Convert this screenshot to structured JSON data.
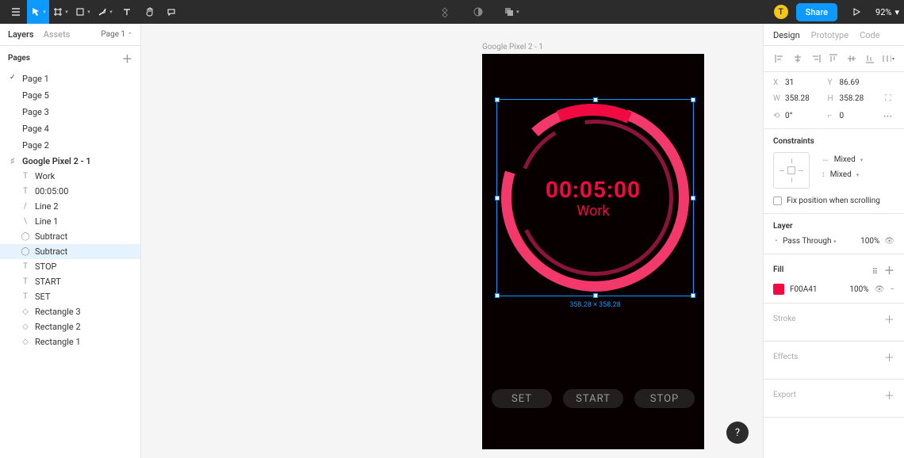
{
  "toolbar": {
    "share_label": "Share",
    "zoom": "92%",
    "avatar_initial": "T"
  },
  "left": {
    "tabs": {
      "layers": "Layers",
      "assets": "Assets"
    },
    "page_selector": "Page 1",
    "pages_header": "Pages",
    "pages": [
      "Page 1",
      "Page 5",
      "Page 3",
      "Page 4",
      "Page 2"
    ],
    "frame_name": "Google Pixel 2 - 1",
    "layers": [
      {
        "icon": "T",
        "label": "Work"
      },
      {
        "icon": "T",
        "label": "00:05:00"
      },
      {
        "icon": "/",
        "label": "Line 2"
      },
      {
        "icon": "\\",
        "label": "Line 1"
      },
      {
        "icon": "◯",
        "label": "Subtract"
      },
      {
        "icon": "◯",
        "label": "Subtract",
        "selected": true
      },
      {
        "icon": "T",
        "label": "STOP"
      },
      {
        "icon": "T",
        "label": "START"
      },
      {
        "icon": "T",
        "label": "SET"
      },
      {
        "icon": "◇",
        "label": "Rectangle 3"
      },
      {
        "icon": "◇",
        "label": "Rectangle 2"
      },
      {
        "icon": "◇",
        "label": "Rectangle 1"
      }
    ]
  },
  "canvas": {
    "frame_label": "Google Pixel 2 - 1",
    "timer": "00:05:00",
    "label": "Work",
    "buttons": {
      "set": "SET",
      "start": "START",
      "stop": "STOP"
    },
    "selection_dim": "358.28 × 358.28"
  },
  "right": {
    "tabs": {
      "design": "Design",
      "prototype": "Prototype",
      "code": "Code"
    },
    "x": "31",
    "y": "86.69",
    "w": "358.28",
    "h": "358.28",
    "rotation": "0°",
    "radius": "0",
    "constraints_h": "Constraints",
    "mixed": "Mixed",
    "fix_pos": "Fix position when scrolling",
    "layer_h": "Layer",
    "blend": "Pass Through",
    "opacity": "100%",
    "fill_h": "Fill",
    "fill_hex": "F00A41",
    "fill_opacity": "100%",
    "stroke_h": "Stroke",
    "effects_h": "Effects",
    "export_h": "Export"
  }
}
